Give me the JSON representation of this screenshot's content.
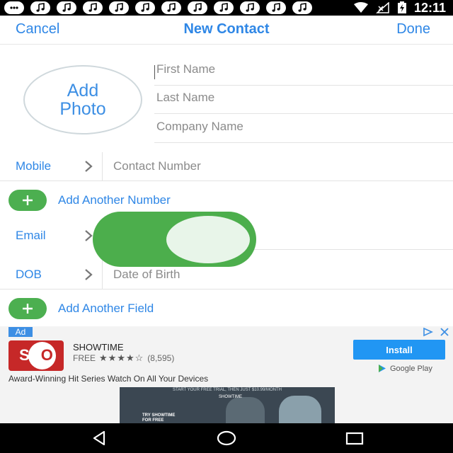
{
  "status_bar": {
    "time": "12:11",
    "notification_icons": [
      "chat-icon",
      "music-note-icon",
      "music-note-icon",
      "music-note-icon",
      "music-note-icon",
      "music-note-icon",
      "music-note-icon",
      "music-note-icon",
      "music-note-icon",
      "music-note-icon",
      "music-note-icon",
      "music-note-icon"
    ],
    "system_icons": [
      "wifi-icon",
      "no-signal-icon",
      "battery-charging-icon"
    ]
  },
  "nav_bar": {
    "cancel_label": "Cancel",
    "title": "New Contact",
    "done_label": "Done"
  },
  "contact_form": {
    "add_photo_label": "Add\nPhoto",
    "first_name_placeholder": "First Name",
    "last_name_placeholder": "Last Name",
    "company_placeholder": "Company Name",
    "mobile": {
      "label": "Mobile",
      "placeholder": "Contact Number"
    },
    "add_number_label": "Add Another Number",
    "email": {
      "label": "Email",
      "toggle_on": true
    },
    "dob": {
      "label": "DOB",
      "placeholder": "Date of Birth"
    },
    "add_field_label": "Add Another Field"
  },
  "ad": {
    "tag": "Ad",
    "logo_text_1": "SH",
    "logo_text_2": "O",
    "app_name": "SHOWTIME",
    "price": "FREE",
    "stars": "★★★★☆",
    "rating_count": "(8,595)",
    "install_label": "Install",
    "store_label": "Google Play",
    "description": "Award-Winning Hit Series Watch On All Your Devices",
    "banner_top_text": "START YOUR FREE TRIAL, THEN JUST $10.99/MONTH",
    "banner_logo_text": "SHOWTIME",
    "banner_cta": "TRY SHOWTIME\nFOR FREE"
  },
  "colors": {
    "accent": "#2f87e6",
    "toggle_green": "#4cae4c",
    "install_blue": "#2196f3",
    "showtime_red": "#c62828"
  },
  "nav_buttons": [
    "back-icon",
    "home-icon",
    "recents-icon"
  ]
}
